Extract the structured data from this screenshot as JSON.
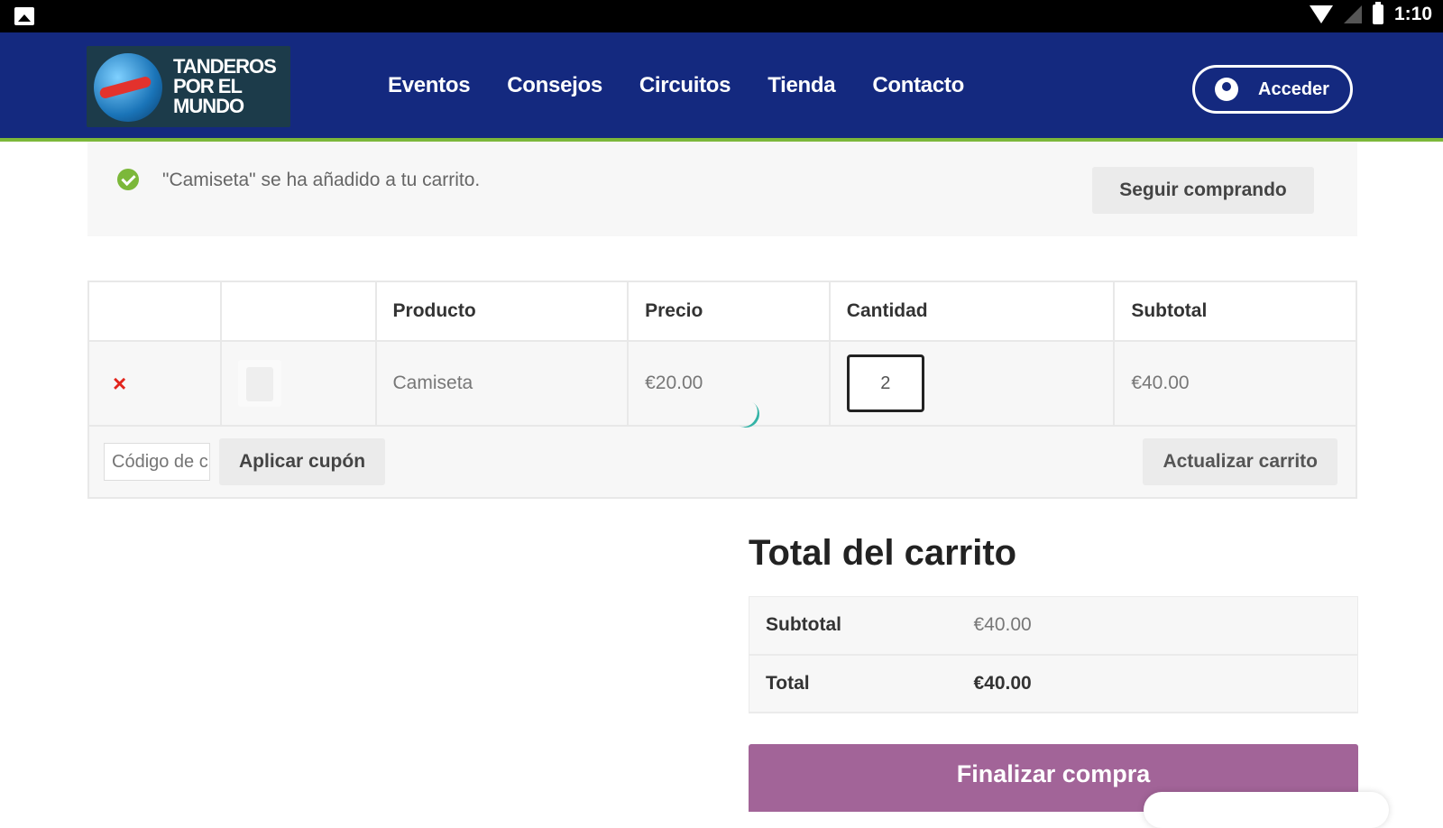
{
  "status_bar": {
    "time": "1:10"
  },
  "header": {
    "logo_text_line1": "TANDEROS",
    "logo_text_line2": "POR EL",
    "logo_text_line3": "MUNDO",
    "nav": [
      "Eventos",
      "Consejos",
      "Circuitos",
      "Tienda",
      "Contacto"
    ],
    "login_label": "Acceder"
  },
  "notice": {
    "message": "\"Camiseta\" se ha añadido a tu carrito.",
    "continue_label": "Seguir comprando"
  },
  "cart": {
    "headers": [
      "",
      "",
      "Producto",
      "Precio",
      "Cantidad",
      "Subtotal"
    ],
    "items": [
      {
        "remove": "×",
        "product": "Camiseta",
        "price": "€20.00",
        "quantity": "2",
        "subtotal": "€40.00"
      }
    ],
    "coupon_placeholder": "Código de cupón",
    "apply_coupon_label": "Aplicar cupón",
    "update_cart_label": "Actualizar carrito"
  },
  "totals": {
    "title": "Total del carrito",
    "rows": [
      {
        "label": "Subtotal",
        "value": "€40.00"
      },
      {
        "label": "Total",
        "value": "€40.00"
      }
    ],
    "checkout_label": "Finalizar compra"
  },
  "colors": {
    "header_bg": "#14297f",
    "accent_green": "#7cb83a",
    "checkout_purple": "#a26498",
    "remove_red": "#e2251d"
  }
}
